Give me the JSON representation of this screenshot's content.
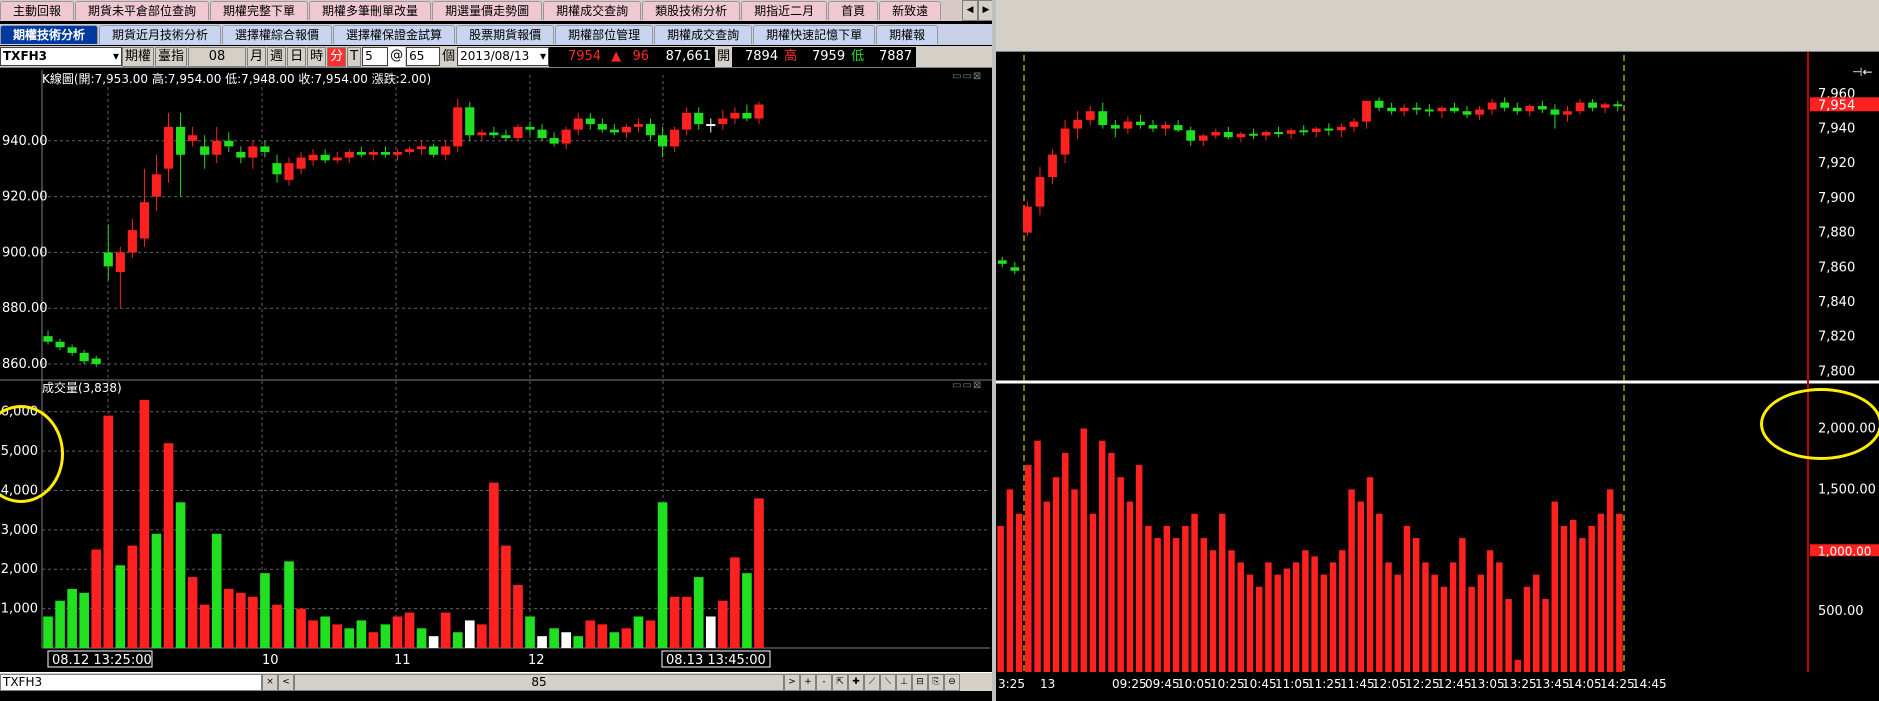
{
  "tabs_row1": [
    "主動回報",
    "期貨未平倉部位查詢",
    "期權完整下單",
    "期權多筆刪單改量",
    "期選量價走勢圖",
    "期權成交查詢",
    "類股技術分析",
    "期指近二月",
    "首頁",
    "新致遠"
  ],
  "tabs_row2": [
    "期權技術分析",
    "期貨近月技術分析",
    "選擇權綜合報價",
    "選擇權保證金試算",
    "股票期貨報價",
    "期權部位管理",
    "期權成交查詢",
    "期權快速記憶下單",
    "期權報"
  ],
  "nav_arrows": [
    "◀",
    "▶",
    "◀",
    "▶"
  ],
  "toolbar": {
    "symbol": "TXFH3",
    "type_label": "期權",
    "index_label": "臺指",
    "contract": "08",
    "period_month": "月",
    "period_week": "週",
    "period_day": "日",
    "period_hour": "時",
    "period_min": "分",
    "tick_label": "T",
    "interval": "5",
    "at_label": "@",
    "count": "65",
    "count_unit": "個",
    "date": "2013/08/13",
    "last": "7954",
    "arrow": "▲",
    "change": "96",
    "volume": "87,661",
    "open_label": "開",
    "open": "7894",
    "high_label": "高",
    "high": "7959",
    "low_label": "低",
    "low": "7887"
  },
  "kline_header": "K線圖(開:7,953.00 高:7,954.00 低:7,948.00 收:7,954.00 漲跌:2.00)",
  "volume_header": "成交量(3,838)",
  "window_icons": "▭▭⊠",
  "left_price_ticks": [
    "940.00",
    "920.00",
    "900.00",
    "880.00",
    "860.00"
  ],
  "left_volume_ticks": [
    "6,000",
    "5,000",
    "4,000",
    "3,000",
    "2,000",
    "1,000"
  ],
  "left_x_labels": [
    "08.12 13:25:00",
    "10",
    "11",
    "12",
    "08.13 13:45:00"
  ],
  "bottom": {
    "symbol": "TXFH3",
    "count": "85",
    "btn_close": "×",
    "btn_left": "<",
    "btn_right": ">",
    "btn_plus": "+",
    "btn_minus": "-",
    "tool_icons": [
      "⇱",
      "✚",
      "⟋",
      "⟍",
      "⊥",
      "⊟",
      "⎘",
      "⊖"
    ]
  },
  "right_price_ticks": [
    "7,960",
    "7,940",
    "7,920",
    "7,900",
    "7,880",
    "7,860",
    "7,840",
    "7,820",
    "7,800"
  ],
  "right_last_price": "7,954",
  "right_volume_ticks": [
    "2,000.00",
    "1,500.00",
    "1,000.00",
    "500.00"
  ],
  "right_last_volume": "1,000.00",
  "right_x_labels": [
    "3:25",
    "13",
    "09:25",
    "09:45",
    "10:05",
    "10:25",
    "10:45",
    "11:05",
    "11:25",
    "11:45",
    "12:05",
    "12:25",
    "12:45",
    "13:05",
    "13:25",
    "13:45",
    "14:05",
    "14:25",
    "14:45"
  ],
  "right_arrow": "⊣←",
  "colors": {
    "up": "#ff2020",
    "down": "#20e020",
    "neutral": "#ffffff",
    "grid": "#606060",
    "highlight": "#ffee00",
    "tab_active": "#003a9e"
  },
  "chart_data": [
    {
      "type": "candlestick",
      "name": "left_kline",
      "ylim": [
        7855,
        7960
      ],
      "ohlc": [
        [
          7870,
          7872,
          7867,
          7868
        ],
        [
          7868,
          7869,
          7865,
          7866
        ],
        [
          7866,
          7867,
          7863,
          7864
        ],
        [
          7864,
          7865,
          7860,
          7861
        ],
        [
          7862,
          7863,
          7859,
          7860
        ],
        [
          7900,
          7910,
          7890,
          7895
        ],
        [
          7893,
          7902,
          7880,
          7900
        ],
        [
          7900,
          7912,
          7898,
          7908
        ],
        [
          7905,
          7930,
          7902,
          7918
        ],
        [
          7920,
          7935,
          7915,
          7928
        ],
        [
          7930,
          7950,
          7925,
          7945
        ],
        [
          7945,
          7950,
          7920,
          7935
        ],
        [
          7940,
          7945,
          7938,
          7942
        ],
        [
          7938,
          7942,
          7930,
          7935
        ],
        [
          7935,
          7945,
          7932,
          7940
        ],
        [
          7940,
          7943,
          7936,
          7938
        ],
        [
          7936,
          7938,
          7932,
          7934
        ],
        [
          7934,
          7940,
          7930,
          7938
        ],
        [
          7938,
          7940,
          7934,
          7936
        ],
        [
          7932,
          7935,
          7925,
          7928
        ],
        [
          7926,
          7934,
          7924,
          7932
        ],
        [
          7930,
          7936,
          7928,
          7934
        ],
        [
          7933,
          7937,
          7931,
          7935
        ],
        [
          7935,
          7937,
          7932,
          7933
        ],
        [
          7933,
          7936,
          7932,
          7934
        ],
        [
          7934,
          7937,
          7932,
          7936
        ],
        [
          7936,
          7938,
          7934,
          7935
        ],
        [
          7935,
          7937,
          7933,
          7936
        ],
        [
          7936,
          7938,
          7934,
          7935
        ],
        [
          7935,
          7937,
          7933,
          7936
        ],
        [
          7936,
          7938,
          7935,
          7937
        ],
        [
          7937,
          7940,
          7935,
          7938
        ],
        [
          7938,
          7939,
          7934,
          7935
        ],
        [
          7935,
          7940,
          7933,
          7938
        ],
        [
          7938,
          7955,
          7936,
          7952
        ],
        [
          7952,
          7954,
          7940,
          7942
        ],
        [
          7942,
          7944,
          7940,
          7943
        ],
        [
          7943,
          7945,
          7941,
          7942
        ],
        [
          7942,
          7944,
          7940,
          7941
        ],
        [
          7941,
          7946,
          7940,
          7945
        ],
        [
          7945,
          7947,
          7942,
          7944
        ],
        [
          7944,
          7946,
          7940,
          7941
        ],
        [
          7941,
          7943,
          7938,
          7939
        ],
        [
          7939,
          7945,
          7937,
          7944
        ],
        [
          7944,
          7950,
          7942,
          7948
        ],
        [
          7948,
          7950,
          7944,
          7946
        ],
        [
          7946,
          7948,
          7943,
          7944
        ],
        [
          7944,
          7946,
          7942,
          7943
        ],
        [
          7943,
          7946,
          7941,
          7945
        ],
        [
          7945,
          7948,
          7943,
          7946
        ],
        [
          7946,
          7948,
          7940,
          7942
        ],
        [
          7942,
          7945,
          7934,
          7938
        ],
        [
          7938,
          7945,
          7936,
          7944
        ],
        [
          7944,
          7952,
          7942,
          7950
        ],
        [
          7950,
          7952,
          7944,
          7946
        ],
        [
          7946,
          7948,
          7943,
          7946
        ],
        [
          7946,
          7951,
          7944,
          7948
        ],
        [
          7948,
          7952,
          7946,
          7950
        ],
        [
          7950,
          7953,
          7947,
          7948
        ],
        [
          7948,
          7954,
          7946,
          7953
        ]
      ],
      "xlabels": [
        "08.12 13:25:00",
        "10",
        "11",
        "12",
        "08.13 13:45:00"
      ]
    },
    {
      "type": "bar",
      "name": "left_volume",
      "ylim": [
        0,
        6500
      ],
      "values": [
        800,
        1200,
        1500,
        1400,
        2500,
        5900,
        2100,
        2600,
        6300,
        2900,
        5200,
        3700,
        1800,
        1100,
        2900,
        1500,
        1400,
        1300,
        1900,
        1100,
        2200,
        1000,
        700,
        800,
        600,
        500,
        700,
        400,
        600,
        800,
        900,
        500,
        300,
        900,
        400,
        700,
        600,
        4200,
        2600,
        1600,
        800,
        300,
        500,
        400,
        300,
        700,
        600,
        400,
        500,
        800,
        700,
        3700,
        1300,
        1300,
        1800,
        800,
        1200,
        2300,
        1900,
        3800
      ],
      "colors": [
        "d",
        "d",
        "d",
        "d",
        "u",
        "u",
        "d",
        "u",
        "u",
        "d",
        "u",
        "d",
        "u",
        "u",
        "d",
        "u",
        "u",
        "u",
        "d",
        "u",
        "d",
        "u",
        "u",
        "d",
        "u",
        "d",
        "d",
        "u",
        "d",
        "u",
        "u",
        "d",
        "n",
        "u",
        "d",
        "n",
        "u",
        "u",
        "u",
        "u",
        "d",
        "n",
        "d",
        "n",
        "d",
        "u",
        "u",
        "d",
        "u",
        "d",
        "u",
        "d",
        "u",
        "u",
        "d",
        "n",
        "u",
        "u",
        "d",
        "u"
      ],
      "yticks": [
        "6,000",
        "5,000",
        "4,000",
        "3,000",
        "2,000",
        "1,000"
      ]
    },
    {
      "type": "candlestick",
      "name": "right_kline",
      "ylim": [
        7795,
        7968
      ],
      "ohlc": [
        [
          7864,
          7866,
          7860,
          7862
        ],
        [
          7860,
          7863,
          7856,
          7858
        ],
        [
          7880,
          7898,
          7878,
          7895
        ],
        [
          7895,
          7918,
          7890,
          7912
        ],
        [
          7912,
          7928,
          7908,
          7925
        ],
        [
          7925,
          7945,
          7920,
          7940
        ],
        [
          7940,
          7950,
          7934,
          7945
        ],
        [
          7945,
          7953,
          7942,
          7950
        ],
        [
          7950,
          7955,
          7940,
          7942
        ],
        [
          7942,
          7945,
          7935,
          7940
        ],
        [
          7940,
          7947,
          7937,
          7944
        ],
        [
          7944,
          7948,
          7940,
          7942
        ],
        [
          7942,
          7945,
          7938,
          7940
        ],
        [
          7940,
          7944,
          7936,
          7942
        ],
        [
          7942,
          7945,
          7938,
          7939
        ],
        [
          7939,
          7941,
          7930,
          7933
        ],
        [
          7933,
          7937,
          7930,
          7936
        ],
        [
          7936,
          7940,
          7934,
          7938
        ],
        [
          7938,
          7941,
          7934,
          7935
        ],
        [
          7935,
          7938,
          7932,
          7937
        ],
        [
          7937,
          7940,
          7934,
          7936
        ],
        [
          7936,
          7939,
          7933,
          7938
        ],
        [
          7938,
          7941,
          7935,
          7937
        ],
        [
          7937,
          7940,
          7934,
          7939
        ],
        [
          7939,
          7942,
          7936,
          7938
        ],
        [
          7938,
          7941,
          7935,
          7940
        ],
        [
          7940,
          7943,
          7936,
          7939
        ],
        [
          7939,
          7943,
          7935,
          7941
        ],
        [
          7941,
          7946,
          7938,
          7944
        ],
        [
          7944,
          7952,
          7940,
          7956
        ],
        [
          7956,
          7958,
          7950,
          7952
        ],
        [
          7952,
          7955,
          7948,
          7950
        ],
        [
          7950,
          7954,
          7947,
          7952
        ],
        [
          7952,
          7955,
          7948,
          7951
        ],
        [
          7951,
          7954,
          7947,
          7950
        ],
        [
          7950,
          7953,
          7946,
          7952
        ],
        [
          7952,
          7955,
          7949,
          7950
        ],
        [
          7950,
          7953,
          7946,
          7948
        ],
        [
          7948,
          7953,
          7945,
          7951
        ],
        [
          7951,
          7957,
          7948,
          7955
        ],
        [
          7955,
          7958,
          7950,
          7952
        ],
        [
          7952,
          7955,
          7948,
          7950
        ],
        [
          7950,
          7954,
          7947,
          7953
        ],
        [
          7953,
          7956,
          7949,
          7951
        ],
        [
          7951,
          7954,
          7940,
          7948
        ],
        [
          7948,
          7953,
          7944,
          7950
        ],
        [
          7950,
          7957,
          7948,
          7955
        ],
        [
          7955,
          7957,
          7950,
          7952
        ],
        [
          7952,
          7955,
          7949,
          7954
        ],
        [
          7954,
          7956,
          7950,
          7953
        ]
      ]
    },
    {
      "type": "bar",
      "name": "right_volume",
      "ylim": [
        0,
        2300
      ],
      "values": [
        1200,
        1500,
        1300,
        1700,
        1900,
        1400,
        1600,
        1800,
        1500,
        2000,
        1300,
        1900,
        1800,
        1600,
        1400,
        1700,
        1200,
        1100,
        1200,
        1100,
        1200,
        1300,
        1100,
        1000,
        1300,
        1000,
        900,
        800,
        700,
        900,
        800,
        850,
        900,
        1000,
        950,
        800,
        900,
        1000,
        1500,
        1400,
        1600,
        1300,
        900,
        800,
        1200,
        1100,
        900,
        800,
        700,
        900,
        1100,
        700,
        800,
        1000,
        900,
        600,
        100,
        700,
        800,
        600,
        1400,
        1200,
        1250,
        1100,
        1200,
        1300,
        1500,
        1300
      ],
      "yticks": [
        "2,000.00",
        "1,500.00",
        "1,000.00",
        "500.00"
      ]
    }
  ]
}
